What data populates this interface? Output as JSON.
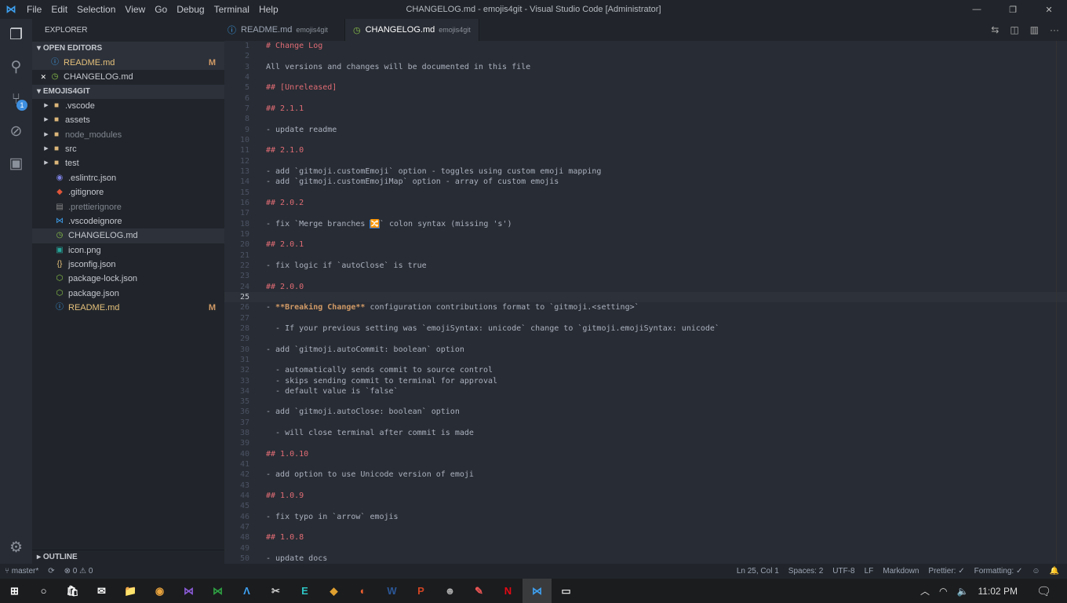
{
  "window": {
    "title": "CHANGELOG.md - emojis4git - Visual Studio Code [Administrator]"
  },
  "menu": [
    "File",
    "Edit",
    "Selection",
    "View",
    "Go",
    "Debug",
    "Terminal",
    "Help"
  ],
  "activity": {
    "scm_badge": "1"
  },
  "sidebar": {
    "title": "EXPLORER",
    "open_editors_label": "OPEN EDITORS",
    "project_label": "EMOJIS4GIT",
    "outline_label": "OUTLINE",
    "open_editors": [
      {
        "name": "README.md",
        "badge": "M",
        "icon": "info-icon",
        "color": "#e5c07b"
      },
      {
        "name": "CHANGELOG.md",
        "badge": "",
        "icon": "history-icon",
        "color": "#c5c8ce"
      }
    ],
    "files": [
      {
        "name": ".vscode",
        "type": "folder"
      },
      {
        "name": "assets",
        "type": "folder"
      },
      {
        "name": "node_modules",
        "type": "folder",
        "dim": true
      },
      {
        "name": "src",
        "type": "folder"
      },
      {
        "name": "test",
        "type": "folder"
      },
      {
        "name": ".eslintrc.json",
        "type": "file",
        "icon": "eslint-icon",
        "glyph": "◉",
        "gc": "#7b7fe0"
      },
      {
        "name": ".gitignore",
        "type": "file",
        "icon": "git-icon",
        "glyph": "◆",
        "gc": "#e0553a"
      },
      {
        "name": ".prettierignore",
        "type": "file",
        "icon": "prettier-icon",
        "glyph": "▤",
        "gc": "#888",
        "dim": true
      },
      {
        "name": ".vscodeignore",
        "type": "file",
        "icon": "vscode-icon",
        "glyph": "⋈",
        "gc": "#3ea0f0"
      },
      {
        "name": "CHANGELOG.md",
        "type": "file",
        "icon": "history-icon",
        "glyph": "◷",
        "gc": "#8bc34a",
        "selected": true
      },
      {
        "name": "icon.png",
        "type": "file",
        "icon": "image-icon",
        "glyph": "▣",
        "gc": "#26a69a"
      },
      {
        "name": "jsconfig.json",
        "type": "file",
        "icon": "json-icon",
        "glyph": "{}",
        "gc": "#e5c07b"
      },
      {
        "name": "package-lock.json",
        "type": "file",
        "icon": "npm-icon",
        "glyph": "⬡",
        "gc": "#8bc34a"
      },
      {
        "name": "package.json",
        "type": "file",
        "icon": "npm-icon",
        "glyph": "⬡",
        "gc": "#8bc34a"
      },
      {
        "name": "README.md",
        "type": "file",
        "icon": "info-icon",
        "glyph": "ⓘ",
        "gc": "#3ea0f0",
        "badge": "M",
        "color": "#e5c07b"
      }
    ]
  },
  "tabs": [
    {
      "name": "README.md",
      "desc": "emojis4git",
      "icon": "info-icon"
    },
    {
      "name": "CHANGELOG.md",
      "desc": "emojis4git",
      "icon": "history-icon",
      "active": true
    }
  ],
  "editor": {
    "current_line": 25,
    "lines": [
      [
        [
          "# Change Log",
          "h"
        ]
      ],
      [],
      [
        [
          "All versions and changes will be documented in this file",
          ""
        ]
      ],
      [],
      [
        [
          "## [Unreleased]",
          "h"
        ]
      ],
      [],
      [
        [
          "## 2.1.1",
          "h"
        ]
      ],
      [],
      [
        [
          "- update readme",
          ""
        ]
      ],
      [],
      [
        [
          "## 2.1.0",
          "h"
        ]
      ],
      [],
      [
        [
          "- add `gitmoji.customEmoji` option - toggles using custom emoji mapping",
          ""
        ]
      ],
      [
        [
          "- add `gitmoji.customEmojiMap` option - array of custom emojis",
          ""
        ]
      ],
      [],
      [
        [
          "## 2.0.2",
          "h"
        ]
      ],
      [],
      [
        [
          "- fix `Merge branches ",
          ""
        ],
        [
          "🔀",
          "em"
        ],
        [
          "` colon syntax (missing 's')",
          ""
        ]
      ],
      [],
      [
        [
          "## 2.0.1",
          "h"
        ]
      ],
      [],
      [
        [
          "- fix logic if `autoClose` is true",
          ""
        ]
      ],
      [],
      [
        [
          "## 2.0.0",
          "h"
        ]
      ],
      [],
      [
        [
          "- ",
          ""
        ],
        [
          "**Breaking Change**",
          "b"
        ],
        [
          " configuration contributions format to `gitmoji.<setting>`",
          ""
        ]
      ],
      [],
      [
        [
          "  - If your previous setting was `emojiSyntax: unicode` change to `gitmoji.emojiSyntax: unicode`",
          ""
        ]
      ],
      [],
      [
        [
          "- add `gitmoji.autoCommit: boolean` option",
          ""
        ]
      ],
      [],
      [
        [
          "  - automatically sends commit to source control",
          ""
        ]
      ],
      [
        [
          "  - skips sending commit to terminal for approval",
          ""
        ]
      ],
      [
        [
          "  - default value is `false`",
          ""
        ]
      ],
      [],
      [
        [
          "- add `gitmoji.autoClose: boolean` option",
          ""
        ]
      ],
      [],
      [
        [
          "  - will close terminal after commit is made",
          ""
        ]
      ],
      [],
      [
        [
          "## 1.0.10",
          "h"
        ]
      ],
      [],
      [
        [
          "- add option to use Unicode version of emoji",
          ""
        ]
      ],
      [],
      [
        [
          "## 1.0.9",
          "h"
        ]
      ],
      [],
      [
        [
          "- fix typo in `arrow` emojis",
          ""
        ]
      ],
      [],
      [
        [
          "## 1.0.8",
          "h"
        ]
      ],
      [],
      [
        [
          "- update docs",
          ""
        ]
      ]
    ]
  },
  "status": {
    "branch": "master*",
    "errors": "0",
    "warnings": "0",
    "position": "Ln 25, Col 1",
    "spaces": "Spaces: 2",
    "encoding": "UTF-8",
    "eol": "LF",
    "language": "Markdown",
    "prettier": "Prettier: ✓",
    "formatting": "Formatting: ✓"
  },
  "taskbar": {
    "apps": [
      {
        "n": "start",
        "g": "⊞",
        "c": "#fff"
      },
      {
        "n": "cortana",
        "g": "○",
        "c": "#fff"
      },
      {
        "n": "store",
        "g": "🛍",
        "c": "#fff"
      },
      {
        "n": "mail",
        "g": "✉",
        "c": "#fff"
      },
      {
        "n": "file-explorer",
        "g": "📁",
        "c": "#f0c040"
      },
      {
        "n": "chrome",
        "g": "◉",
        "c": "#e8a33d"
      },
      {
        "n": "visual-studio",
        "g": "⋈",
        "c": "#8a5bd6"
      },
      {
        "n": "vscode-insiders",
        "g": "⋈",
        "c": "#2ea043"
      },
      {
        "n": "arduino",
        "g": "Λ",
        "c": "#3ea0f0"
      },
      {
        "n": "snipping",
        "g": "✂",
        "c": "#ccc"
      },
      {
        "n": "editor",
        "g": "E",
        "c": "#2ec4c4"
      },
      {
        "n": "git-kraken",
        "g": "◆",
        "c": "#e0a030"
      },
      {
        "n": "postman",
        "g": "◐",
        "c": "#f06030"
      },
      {
        "n": "word",
        "g": "W",
        "c": "#2b5797"
      },
      {
        "n": "powerpoint",
        "g": "P",
        "c": "#d04423"
      },
      {
        "n": "gimp",
        "g": "☻",
        "c": "#aaa"
      },
      {
        "n": "paint",
        "g": "✎",
        "c": "#e55"
      },
      {
        "n": "netflix",
        "g": "N",
        "c": "#e50914"
      },
      {
        "n": "vscode",
        "g": "⋈",
        "c": "#3ea0f0",
        "active": true
      },
      {
        "n": "connect",
        "g": "▭",
        "c": "#ddd"
      }
    ],
    "time": "11:02 PM"
  }
}
